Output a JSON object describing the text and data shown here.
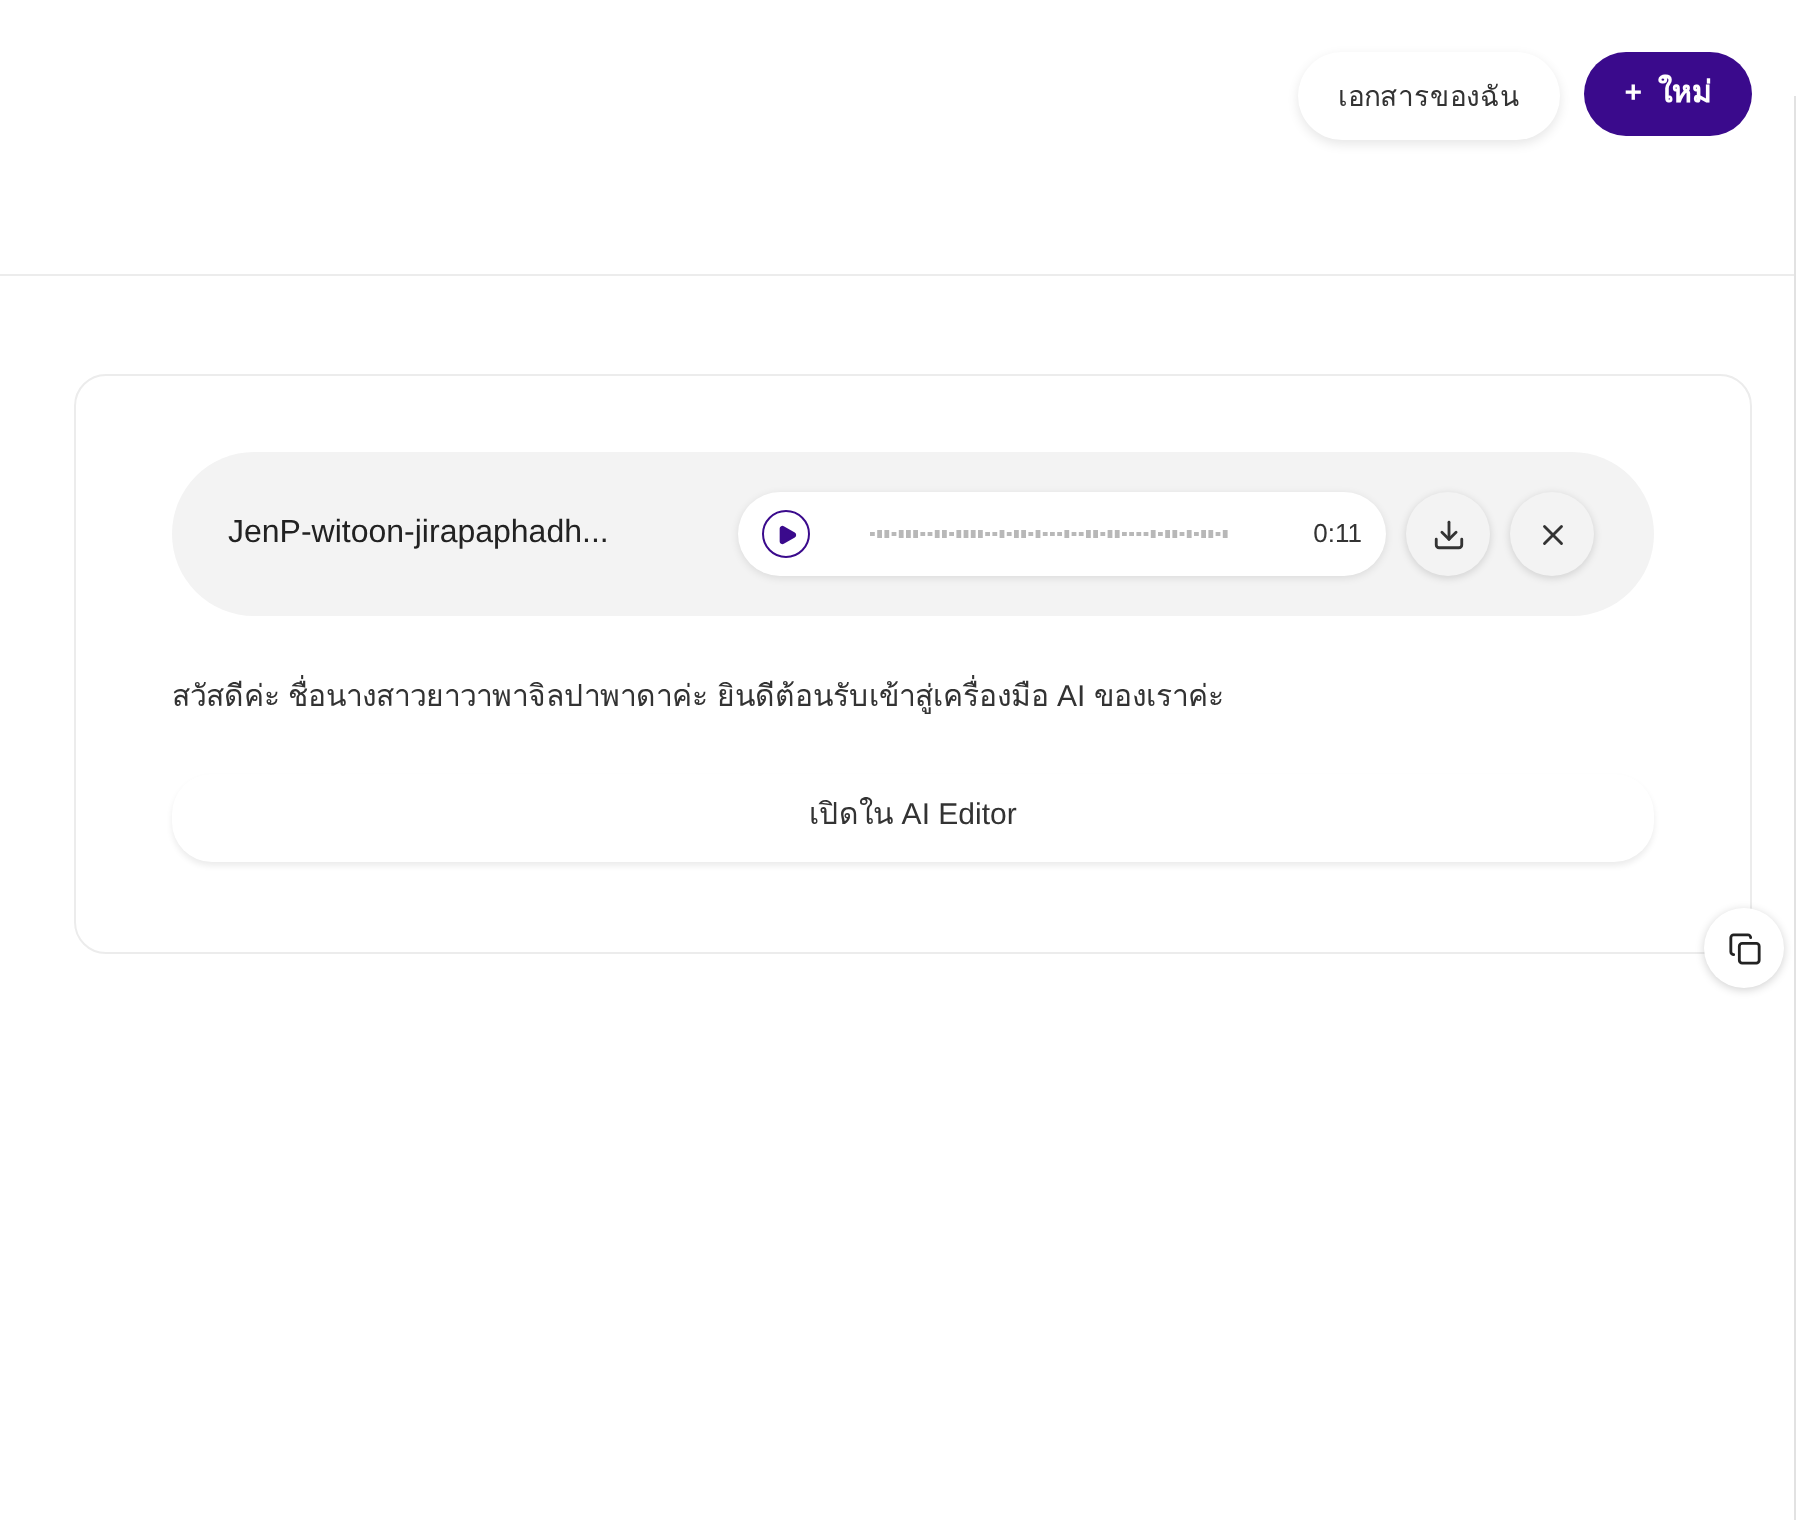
{
  "header": {
    "documents_button": "เอกสารของฉัน",
    "new_button": {
      "icon": "+",
      "label": "ใหม่"
    }
  },
  "audio": {
    "filename": "JenP-witoon-jirapaphadh...",
    "duration": "0:11",
    "playing": false
  },
  "transcript": "สวัสดีค่ะ ชื่อนางสาวยาวาพาจิลปาพาดาค่ะ ยินดีต้อนรับเข้าสู่เครื่องมือ AI ของเราค่ะ",
  "open_button": "เปิดใน AI Editor"
}
